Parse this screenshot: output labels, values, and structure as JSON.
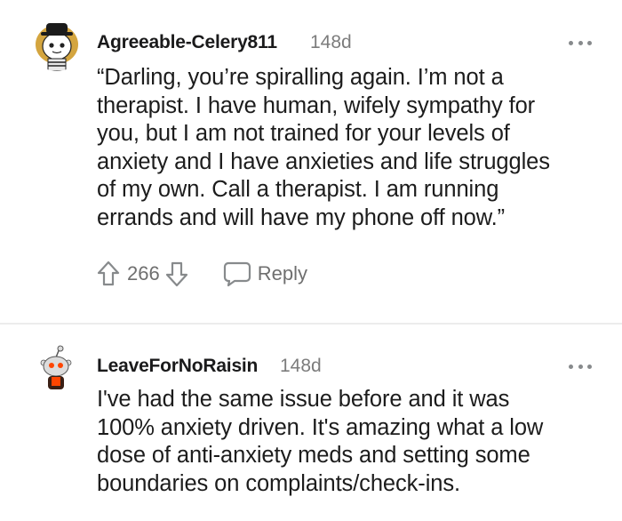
{
  "comments": [
    {
      "username": "Agreeable-Celery811",
      "age": "148d",
      "body": "“Darling, you’re spiralling again. I’m not a\ntherapist. I have human, wifely sympathy for\nyou, but I am not trained for your levels of\nanxiety and I have anxieties and life struggles\nof my own. Call a therapist. I am running\nerrands and will have my phone off now.”",
      "score": "266",
      "reply_label": "Reply",
      "icons": {
        "upvote": "upvote-icon",
        "downvote": "downvote-icon",
        "reply": "reply-icon",
        "more": "more-options-icon"
      }
    },
    {
      "username": "LeaveForNoRaisin",
      "age": "148d",
      "body": "I've had the same issue before and it was\n100% anxiety driven. It's amazing what a low\ndose of anti-anxiety meds and setting some\nboundaries on complaints/check-ins.",
      "icons": {
        "more": "more-options-icon"
      }
    }
  ],
  "colors": {
    "text": "#1c1c1c",
    "meta": "#7c7c7c",
    "icon": "#878a8c",
    "divider": "#ececec",
    "background": "#ffffff"
  }
}
